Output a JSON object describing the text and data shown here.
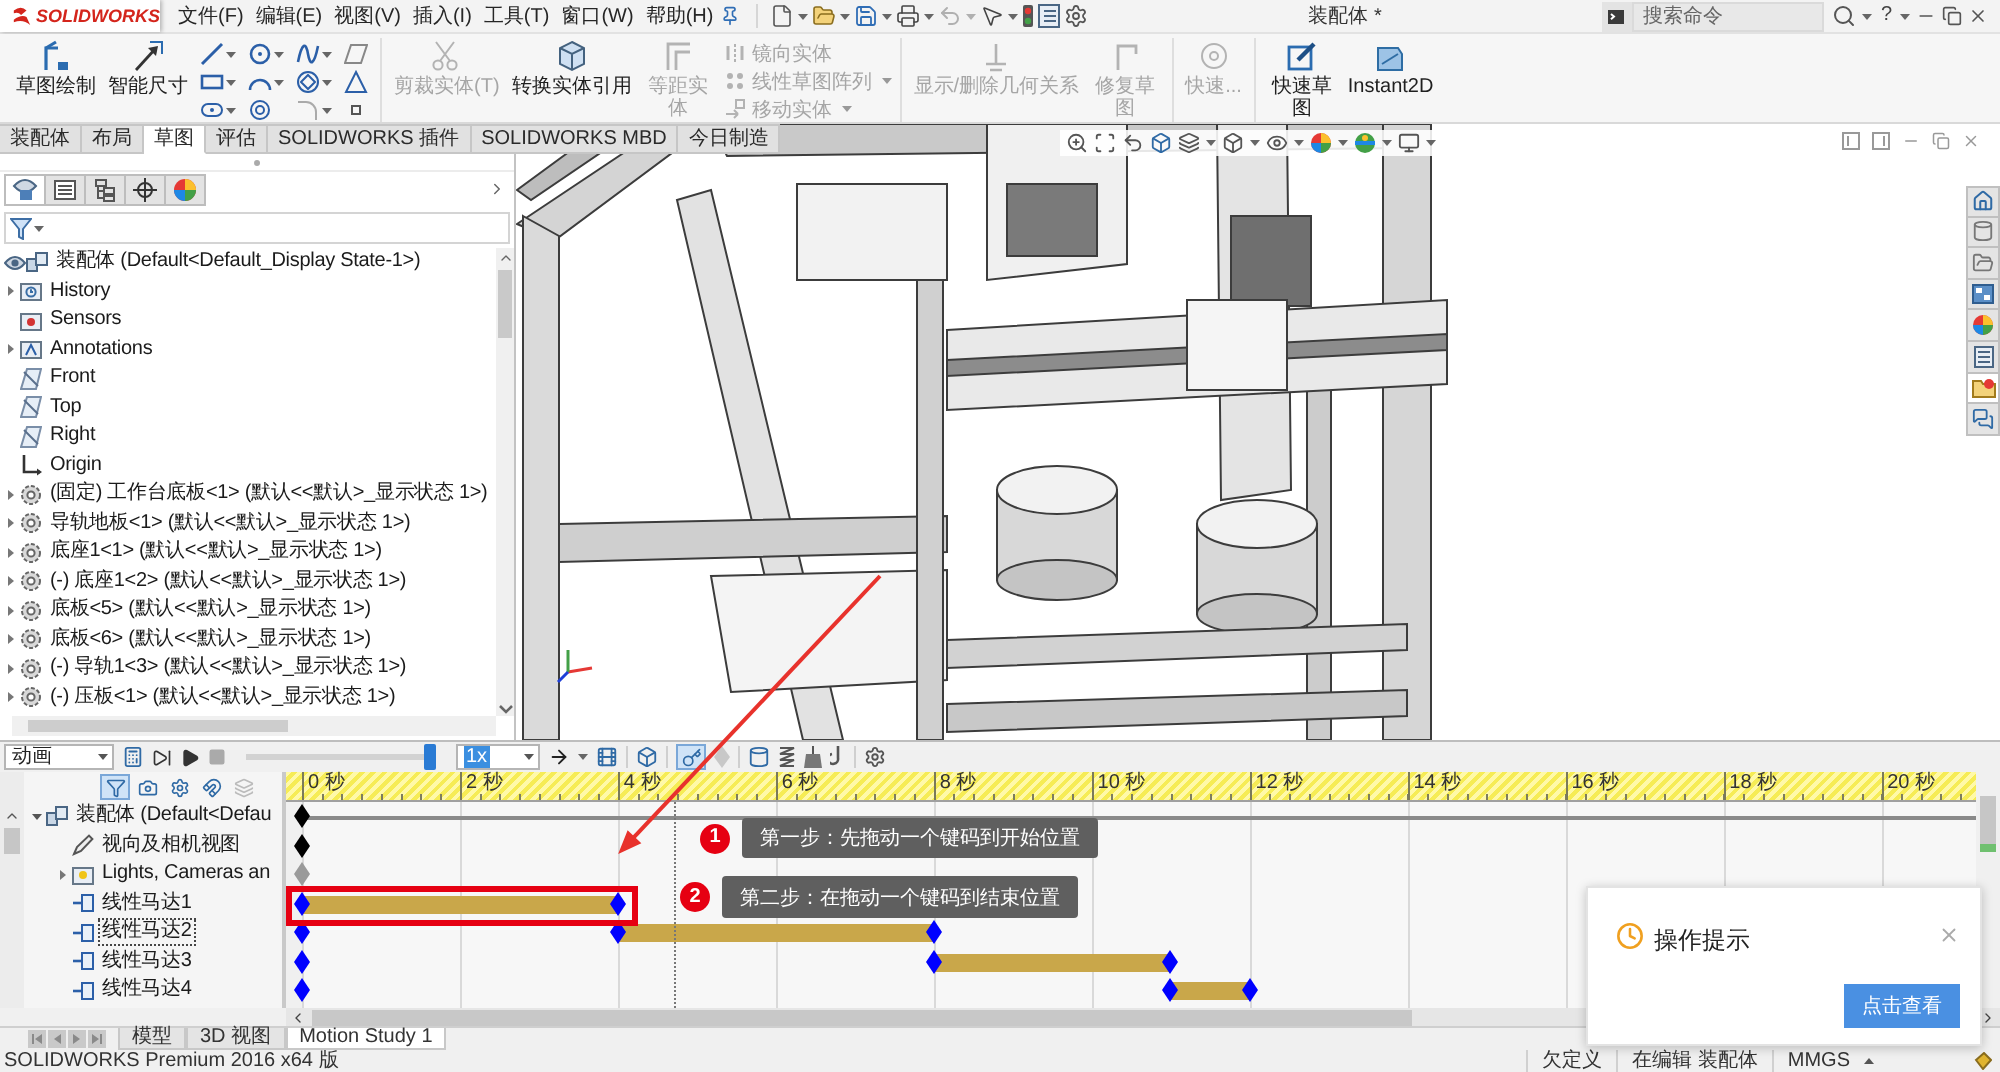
{
  "app": {
    "logo": "SOLIDWORKS",
    "title": "装配体 *",
    "help": "?"
  },
  "menu": [
    "文件(F)",
    "编辑(E)",
    "视图(V)",
    "插入(I)",
    "工具(T)",
    "窗口(W)",
    "帮助(H)"
  ],
  "search": {
    "placeholder": "搜索命令"
  },
  "command_manager": {
    "groups": [
      [
        {
          "kind": "sketch",
          "label": "草图绘制",
          "disabled": false
        },
        {
          "kind": "dimension",
          "label": "智能尺寸",
          "disabled": false
        },
        {
          "kind": "tool-grid"
        }
      ],
      [
        {
          "kind": "trim",
          "label": "剪裁实体(T)",
          "disabled": true
        },
        {
          "kind": "convert",
          "label": "转换实体引用",
          "disabled": false
        },
        {
          "kind": "offset",
          "label": "等距实体",
          "disabled": true
        },
        {
          "kind": "tool-list",
          "entries": [
            {
              "label": "镜向实体",
              "disabled": true
            },
            {
              "label": "线性草图阵列",
              "disabled": true
            },
            {
              "label": "移动实体",
              "disabled": true
            }
          ]
        }
      ],
      [
        {
          "kind": "relations",
          "label": "显示/删除几何关系",
          "disabled": true
        },
        {
          "kind": "repair",
          "label": "修复草图",
          "disabled": true
        }
      ],
      [
        {
          "kind": "snaps",
          "label": "快速...",
          "disabled": true
        }
      ],
      [
        {
          "kind": "rapid-sketch",
          "label": "快速草图",
          "disabled": false
        },
        {
          "kind": "instant2d",
          "label": "Instant2D",
          "disabled": false
        }
      ]
    ]
  },
  "command_tabs": [
    {
      "label": "装配体",
      "selected": false
    },
    {
      "label": "布局",
      "selected": false
    },
    {
      "label": "草图",
      "selected": true
    },
    {
      "label": "评估",
      "selected": false
    },
    {
      "label": "SOLIDWORKS 插件",
      "selected": false
    },
    {
      "label": "SOLIDWORKS MBD",
      "selected": false
    },
    {
      "label": "今日制造",
      "selected": false
    }
  ],
  "feature_manager": {
    "tabs": [
      {
        "kind": "tree",
        "selected": true
      },
      {
        "kind": "properties",
        "selected": false
      },
      {
        "kind": "configurations",
        "selected": false
      },
      {
        "kind": "dimxpert",
        "selected": false
      },
      {
        "kind": "display",
        "selected": false
      }
    ],
    "root": "装配体 (Default<Default_Display State-1>)",
    "items": [
      {
        "kind": "history",
        "label": "History",
        "expanded": false
      },
      {
        "kind": "sensors",
        "label": "Sensors"
      },
      {
        "kind": "annotations",
        "label": "Annotations",
        "expanded": false
      },
      {
        "kind": "plane",
        "label": "Front"
      },
      {
        "kind": "plane",
        "label": "Top"
      },
      {
        "kind": "plane",
        "label": "Right"
      },
      {
        "kind": "origin",
        "label": "Origin"
      },
      {
        "kind": "part",
        "label": "(固定) 工作台底板<1> (默认<<默认>_显示状态 1>)",
        "expanded": false
      },
      {
        "kind": "part",
        "label": "导轨地板<1> (默认<<默认>_显示状态 1>)",
        "expanded": false
      },
      {
        "kind": "part",
        "label": "底座1<1> (默认<<默认>_显示状态 1>)",
        "expanded": false
      },
      {
        "kind": "part",
        "label": "(-) 底座1<2> (默认<<默认>_显示状态 1>)",
        "expanded": false
      },
      {
        "kind": "part",
        "label": "底板<5> (默认<<默认>_显示状态 1>)",
        "expanded": false
      },
      {
        "kind": "part",
        "label": "底板<6> (默认<<默认>_显示状态 1>)",
        "expanded": false
      },
      {
        "kind": "part",
        "label": "(-) 导轨1<3> (默认<<默认>_显示状态 1>)",
        "expanded": false
      },
      {
        "kind": "part",
        "label": "(-) 压板<1> (默认<<默认>_显示状态 1>)",
        "expanded": false
      }
    ]
  },
  "task_pane": {
    "tabs": [
      {
        "kind": "home",
        "selected": false
      },
      {
        "kind": "library",
        "selected": false
      },
      {
        "kind": "explorer",
        "selected": false
      },
      {
        "kind": "view-palette",
        "selected": false
      },
      {
        "kind": "appearances",
        "selected": false
      },
      {
        "kind": "properties",
        "selected": false
      },
      {
        "kind": "recovery",
        "selected": true
      },
      {
        "kind": "forum",
        "selected": false
      }
    ]
  },
  "motion_study": {
    "type": "动画",
    "speed": "1x",
    "playback": {
      "level": 1
    },
    "autokey": true,
    "filters": [
      {
        "kind": "animated",
        "selected": true
      },
      {
        "kind": "driving",
        "selected": false
      },
      {
        "kind": "selected",
        "selected": false
      },
      {
        "kind": "results",
        "selected": false
      },
      {
        "kind": "hidden",
        "selected": false
      }
    ],
    "ruler": [
      "0 秒",
      "2 秒",
      "4 秒",
      "6 秒",
      "8 秒",
      "10 秒",
      "12 秒",
      "14 秒",
      "16 秒",
      "18 秒",
      "20 秒"
    ],
    "time_cursor": {
      "level": 0.222
    },
    "tree": [
      {
        "kind": "assembly",
        "label": "装配体 (Default<Defau",
        "expanded": true,
        "selected": false,
        "keys": [
          {
            "level": 0,
            "changed": false
          }
        ],
        "children": [
          {
            "kind": "camera",
            "label": "视向及相机视图",
            "selected": false,
            "keys": [
              {
                "level": 0,
                "changed": false
              }
            ]
          },
          {
            "kind": "lights",
            "label": "Lights, Cameras an",
            "expanded": false,
            "selected": false,
            "keys": [
              {
                "level": 0,
                "changed": false
              }
            ]
          },
          {
            "kind": "motor",
            "label": "线性马达1",
            "selected": false,
            "keys": [
              {
                "level": 0,
                "changed": false
              },
              {
                "level": 0.189,
                "changed": true
              }
            ]
          },
          {
            "kind": "motor",
            "label": "线性马达2",
            "selected": true,
            "keys": [
              {
                "level": 0,
                "changed": false
              },
              {
                "level": 0.189,
                "changed": false
              },
              {
                "level": 0.377,
                "changed": true
              }
            ]
          },
          {
            "kind": "motor",
            "label": "线性马达3",
            "selected": false,
            "keys": [
              {
                "level": 0,
                "changed": false
              },
              {
                "level": 0.377,
                "changed": false
              },
              {
                "level": 0.519,
                "changed": true
              }
            ]
          },
          {
            "kind": "motor",
            "label": "线性马达4",
            "selected": false,
            "keys": [
              {
                "level": 0,
                "changed": false
              },
              {
                "level": 0.519,
                "changed": false
              },
              {
                "level": 0.566,
                "changed": true
              }
            ]
          }
        ]
      }
    ],
    "callouts": [
      {
        "number": "1",
        "text": "第一步：先拖动一个键码到开始位置"
      },
      {
        "number": "2",
        "text": "第二步：在拖动一个键码到结束位置"
      }
    ],
    "tabs": [
      {
        "label": "模型",
        "selected": false
      },
      {
        "label": "3D 视图",
        "selected": false
      },
      {
        "label": "Motion Study 1",
        "selected": true
      }
    ]
  },
  "notification": {
    "title": "操作提示",
    "button": "点击查看"
  },
  "status_bar": {
    "product": "SOLIDWORKS Premium 2016 x64 版",
    "items": [
      "欠定义",
      "在编辑 装配体",
      "MMGS"
    ]
  }
}
